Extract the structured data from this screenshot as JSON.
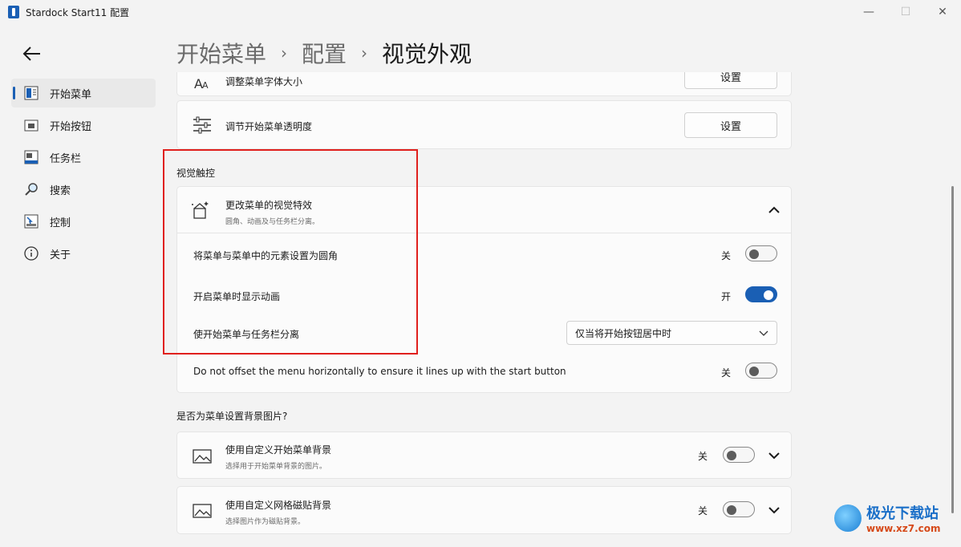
{
  "window": {
    "title": "Stardock Start11 配置",
    "minimize": "—",
    "maximize": "☐",
    "close": "✕"
  },
  "sidebar": {
    "items": [
      {
        "label": "开始菜单",
        "icon": "start-menu-icon",
        "active": true
      },
      {
        "label": "开始按钮",
        "icon": "start-button-icon",
        "active": false
      },
      {
        "label": "任务栏",
        "icon": "taskbar-icon",
        "active": false
      },
      {
        "label": "搜索",
        "icon": "search-icon",
        "active": false
      },
      {
        "label": "控制",
        "icon": "control-icon",
        "active": false
      },
      {
        "label": "关于",
        "icon": "info-icon",
        "active": false
      }
    ]
  },
  "breadcrumb": {
    "items": [
      "开始菜单",
      "配置",
      "视觉外观"
    ],
    "separator": "›"
  },
  "content": {
    "top_partial": {
      "label": "调整菜单字体大小",
      "button": "设置"
    },
    "transparency": {
      "label": "调节开始菜单透明度",
      "button": "设置"
    },
    "visual_section": {
      "title": "视觉触控",
      "header": {
        "title": "更改菜单的视觉特效",
        "subtitle": "圆角、动画及与任务栏分离。"
      },
      "rows": [
        {
          "label": "将菜单与菜单中的元素设置为圆角",
          "state_label": "关",
          "on": false
        },
        {
          "label": "开启菜单时显示动画",
          "state_label": "开",
          "on": true
        }
      ],
      "separate": {
        "label": "使开始菜单与任务栏分离",
        "selected": "仅当将开始按钮居中时"
      },
      "offset": {
        "label": "Do not offset the menu horizontally to ensure it lines up with the start button",
        "state_label": "关",
        "on": false
      }
    },
    "background_section": {
      "title": "是否为菜单设置背景图片?",
      "items": [
        {
          "title": "使用自定义开始菜单背景",
          "subtitle": "选择用于开始菜单背景的图片。",
          "state_label": "关"
        },
        {
          "title": "使用自定义网格磁贴背景",
          "subtitle": "选择图片作为磁贴背景。",
          "state_label": "关"
        }
      ]
    }
  },
  "watermark": {
    "title": "极光下载站",
    "url": "www.xz7.com"
  },
  "colors": {
    "accent": "#1a5fb4",
    "highlight": "#e0201d"
  }
}
